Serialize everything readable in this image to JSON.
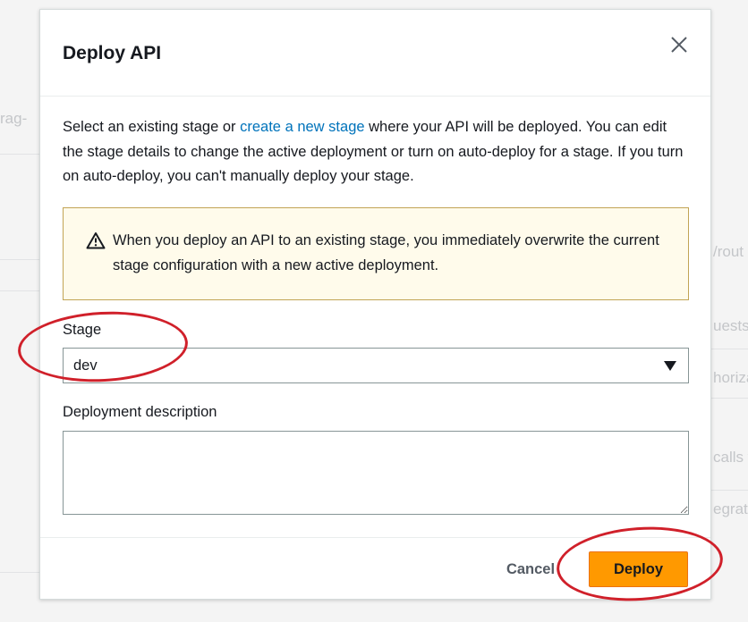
{
  "background": {
    "fragments": [
      "rag-",
      "/rout",
      "uests.",
      "horiza",
      "calls w",
      "egrat"
    ]
  },
  "modal": {
    "title": "Deploy API",
    "close_icon": "close-icon",
    "intro": {
      "before_link": "Select an existing stage or ",
      "link": "create a new stage",
      "after_link": " where your API will be deployed. You can edit the stage details to change the active deployment or turn on auto-deploy for a stage. If you turn on auto-deploy, you can't manually deploy your stage."
    },
    "alert": {
      "icon": "warning-icon",
      "text": "When you deploy an API to an existing stage, you immediately overwrite the current stage configuration with a new active deployment."
    },
    "stage": {
      "label": "Stage",
      "value": "dev",
      "caret_icon": "caret-down-icon"
    },
    "description": {
      "label": "Deployment description",
      "value": ""
    },
    "footer": {
      "cancel_label": "Cancel",
      "deploy_label": "Deploy"
    }
  },
  "colors": {
    "accent_link": "#0073bb",
    "primary_button": "#ff9900",
    "alert_background": "#fffbeb",
    "alert_border": "#c2a455",
    "annotation": "#d0202a"
  }
}
